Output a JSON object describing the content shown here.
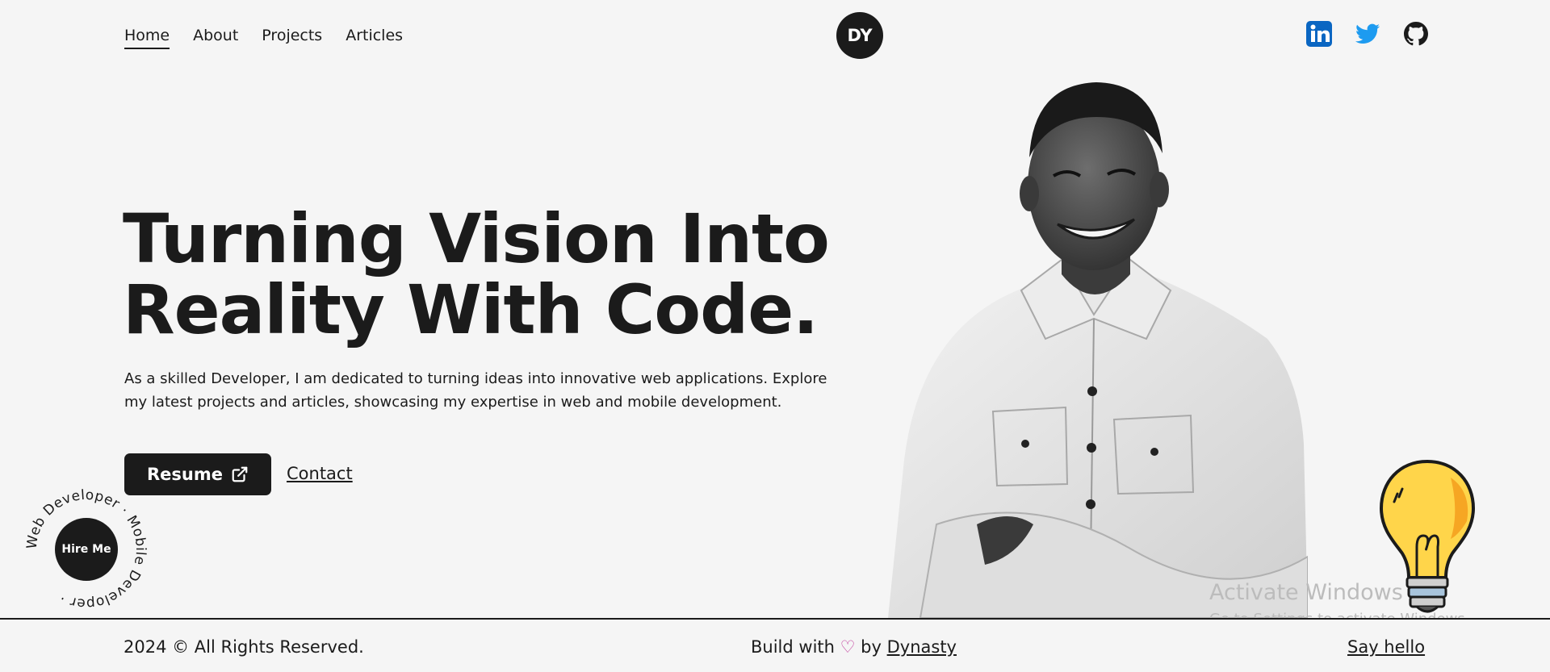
{
  "nav": {
    "items": [
      {
        "label": "Home",
        "active": true
      },
      {
        "label": "About",
        "active": false
      },
      {
        "label": "Projects",
        "active": false
      },
      {
        "label": "Articles",
        "active": false
      }
    ],
    "logo": "DY"
  },
  "socials": [
    {
      "icon": "linkedin-icon",
      "color": "#0a66c2"
    },
    {
      "icon": "twitter-icon",
      "color": "#1d9bf0"
    },
    {
      "icon": "github-icon",
      "color": "#1b1b1b"
    }
  ],
  "hero": {
    "headline_line1": "Turning Vision Into",
    "headline_line2": "Reality With Code.",
    "intro": "As a skilled Developer, I am dedicated to turning ideas into innovative web applications. Explore my latest projects and articles, showcasing my expertise in web and mobile development.",
    "resume_label": "Resume",
    "contact_label": "Contact"
  },
  "hire": {
    "button_label": "Hire Me",
    "ring_text": "Web Developer · Mobile Developer ·"
  },
  "watermark": {
    "line1": "Activate Windows",
    "line2": "Go to Settings to activate Windows."
  },
  "footer": {
    "copyright": "2024 © All Rights Reserved.",
    "build_prefix": "Build with",
    "heart": "♡",
    "build_by": "by",
    "author": "Dynasty",
    "say_hello": "Say hello"
  },
  "colors": {
    "background": "#f5f5f5",
    "dark": "#1b1b1b",
    "heart": "#c0399b"
  }
}
